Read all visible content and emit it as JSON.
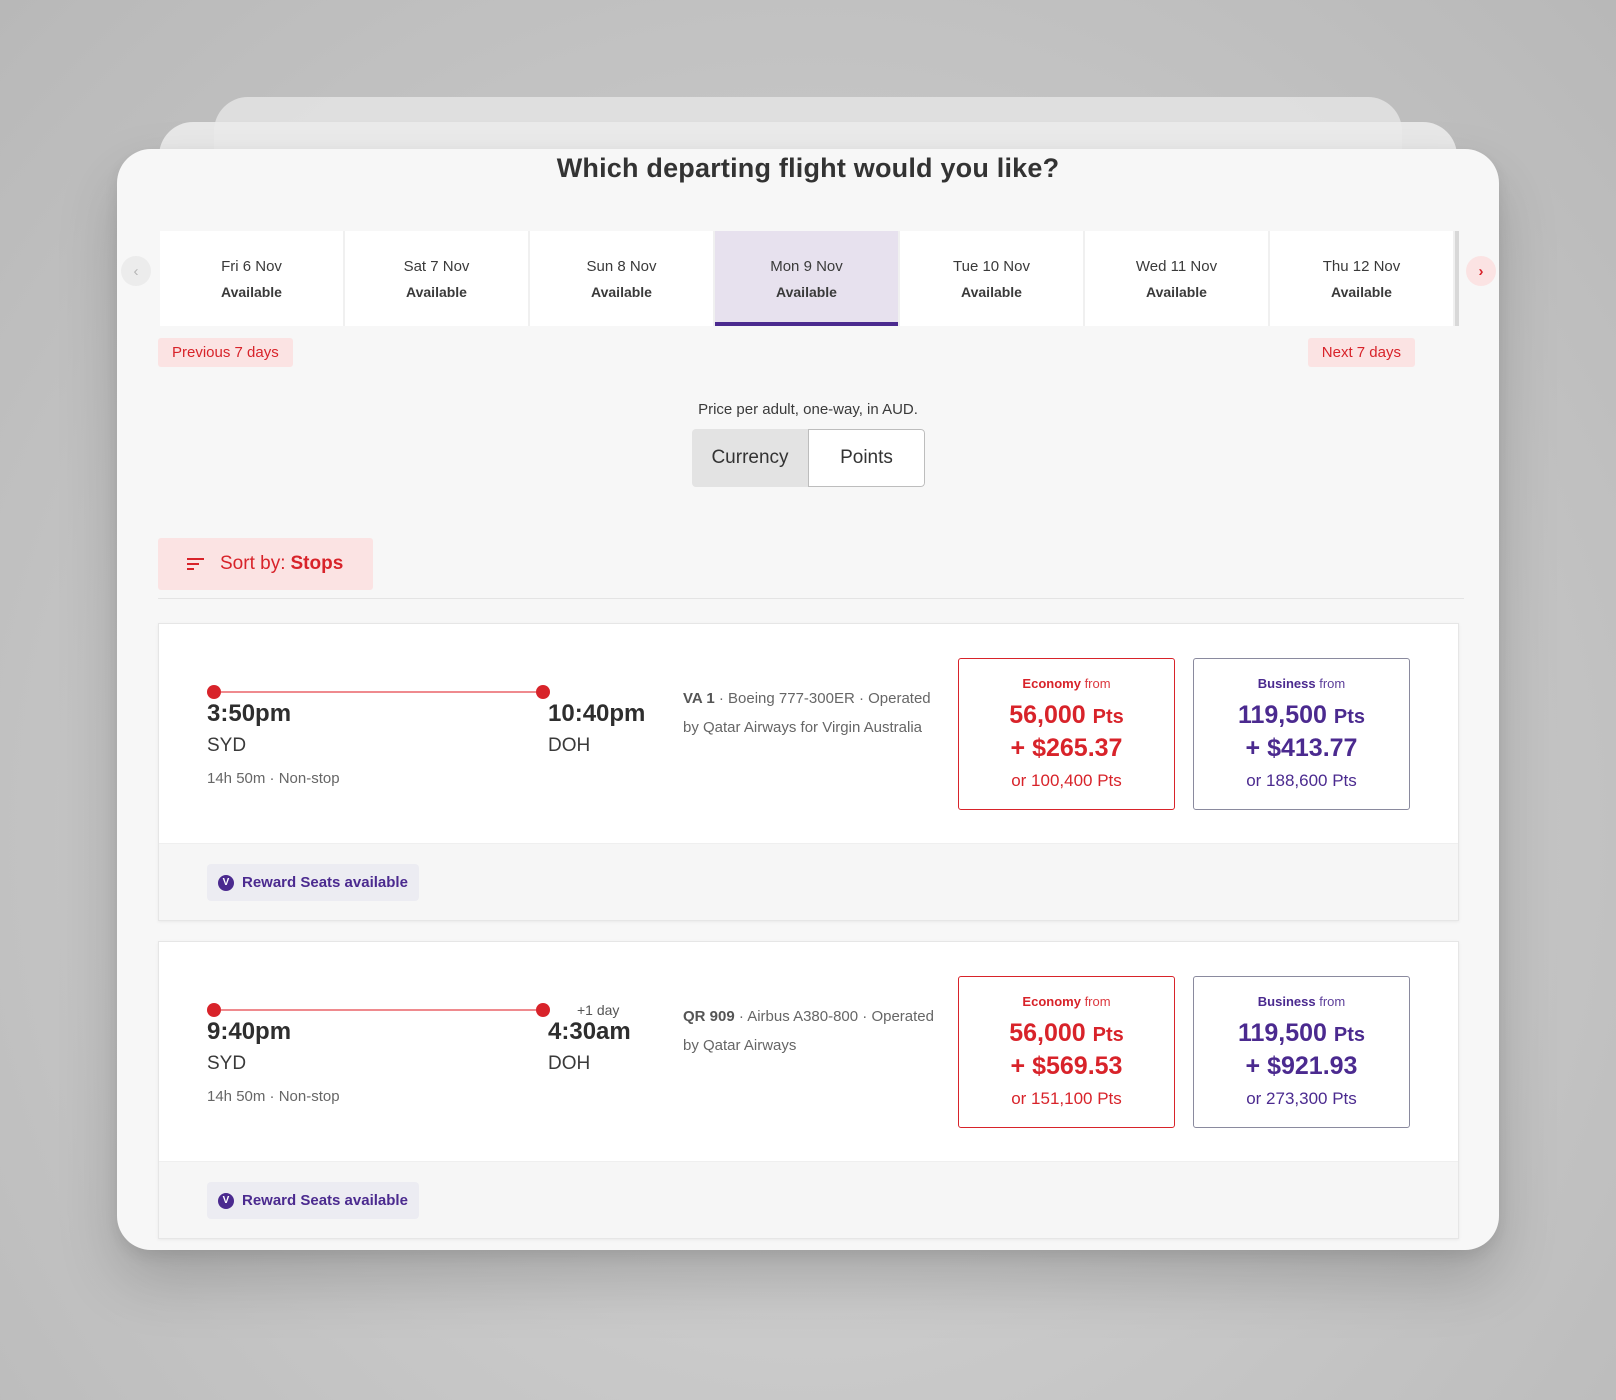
{
  "page": {
    "title": "Which departing flight would you like?"
  },
  "date_nav": {
    "prev_icon": "chevron-left-icon",
    "next_icon": "chevron-right-icon",
    "prev_arrow": "‹",
    "next_arrow": "›",
    "dates": [
      {
        "label": "Fri 6 Nov",
        "status": "Available"
      },
      {
        "label": "Sat 7 Nov",
        "status": "Available"
      },
      {
        "label": "Sun 8 Nov",
        "status": "Available"
      },
      {
        "label": "Mon 9 Nov",
        "status": "Available",
        "selected": true
      },
      {
        "label": "Tue 10 Nov",
        "status": "Available"
      },
      {
        "label": "Wed 11 Nov",
        "status": "Available"
      },
      {
        "label": "Thu 12 Nov",
        "status": "Available"
      }
    ],
    "previous_label": "Previous 7 days",
    "next_label": "Next 7 days"
  },
  "pricing": {
    "note": "Price per adult, one-way, in AUD.",
    "options": [
      "Currency",
      "Points"
    ],
    "selected": "Points"
  },
  "sort": {
    "label": "Sort by:",
    "value": "Stops",
    "icon": "sort-icon"
  },
  "flights": [
    {
      "dep_time": "3:50pm",
      "dep_code": "SYD",
      "arr_time": "10:40pm",
      "arr_code": "DOH",
      "plus_day": "",
      "duration": "14h 50m · Non-stop",
      "flight_no": "VA 1",
      "flight_desc": " · Boeing 777-300ER · Operated by Qatar Airways for Virgin Australia",
      "economy": {
        "head": "Economy",
        "from": "from",
        "pts": "56,000",
        "pts_unit": "Pts",
        "cash": "+ $265.37",
        "alt": "or 100,400 Pts"
      },
      "business": {
        "head": "Business",
        "from": "from",
        "pts": "119,500",
        "pts_unit": "Pts",
        "cash": "+ $413.77",
        "alt": "or 188,600 Pts"
      },
      "badge": "Reward Seats available",
      "badge_icon": "V"
    },
    {
      "dep_time": "9:40pm",
      "dep_code": "SYD",
      "arr_time": "4:30am",
      "arr_code": "DOH",
      "plus_day": "+1 day",
      "duration": "14h 50m · Non-stop",
      "flight_no": "QR 909",
      "flight_desc": " · Airbus A380-800 · Operated by Qatar Airways",
      "economy": {
        "head": "Economy",
        "from": "from",
        "pts": "56,000",
        "pts_unit": "Pts",
        "cash": "+ $569.53",
        "alt": "or 151,100 Pts"
      },
      "business": {
        "head": "Business",
        "from": "from",
        "pts": "119,500",
        "pts_unit": "Pts",
        "cash": "+ $921.93",
        "alt": "or 273,300 Pts"
      },
      "badge": "Reward Seats available",
      "badge_icon": "V"
    }
  ],
  "colors": {
    "accent_red": "#d8232a",
    "accent_purple": "#4b2a8f",
    "selected_tab_bg": "#e7e1ee",
    "pill_bg": "#fbe3e3"
  }
}
